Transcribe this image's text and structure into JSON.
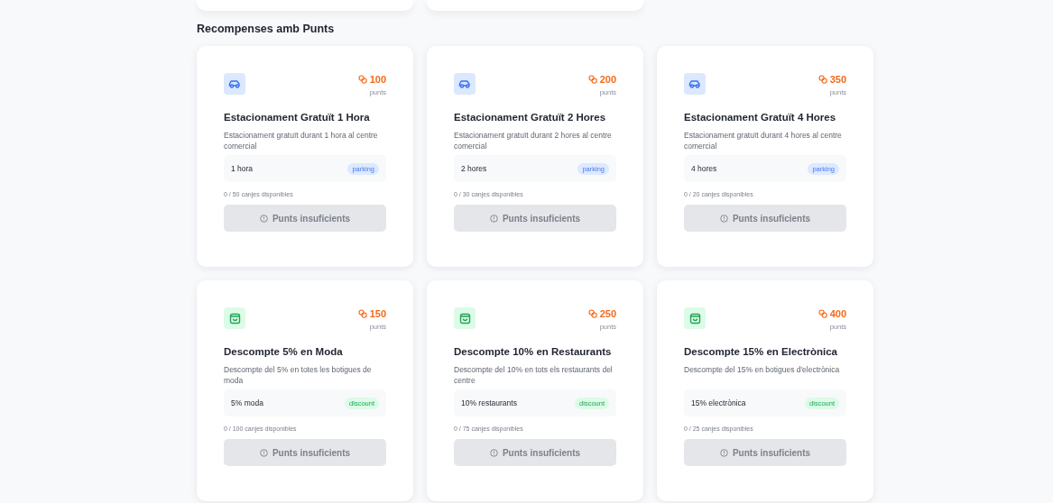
{
  "section_title": "Recompenses amb Punts",
  "rewards": [
    {
      "kind": "parking",
      "points": "100",
      "points_unit": "punts",
      "title": "Estacionament Gratuït 1 Hora",
      "description": "Estacionament gratuït durant 1 hora al centre comercial",
      "value": "1 hora",
      "tag": "parking",
      "availability": "0 / 50 canjes disponibles",
      "button": "Punts insuficients",
      "disabled": true
    },
    {
      "kind": "parking",
      "points": "200",
      "points_unit": "punts",
      "title": "Estacionament Gratuït 2 Hores",
      "description": "Estacionament gratuït durant 2 hores al centre comercial",
      "value": "2 hores",
      "tag": "parking",
      "availability": "0 / 30 canjes disponibles",
      "button": "Punts insuficients",
      "disabled": true
    },
    {
      "kind": "parking",
      "points": "350",
      "points_unit": "punts",
      "title": "Estacionament Gratuït 4 Hores",
      "description": "Estacionament gratuït durant 4 hores al centre comercial",
      "value": "4 hores",
      "tag": "parking",
      "availability": "0 / 20 canjes disponibles",
      "button": "Punts insuficients",
      "disabled": true
    },
    {
      "kind": "discount",
      "points": "150",
      "points_unit": "punts",
      "title": "Descompte 5% en Moda",
      "description": "Descompte del 5% en totes les botigues de moda",
      "value": "5% moda",
      "tag": "discount",
      "availability": "0 / 100 canjes disponibles",
      "button": "Punts insuficients",
      "disabled": true
    },
    {
      "kind": "discount",
      "points": "250",
      "points_unit": "punts",
      "title": "Descompte 10% en Restaurants",
      "description": "Descompte del 10% en tots els restaurants del centre",
      "value": "10% restaurants",
      "tag": "discount",
      "availability": "0 / 75 canjes disponibles",
      "button": "Punts insuficients",
      "disabled": true
    },
    {
      "kind": "discount",
      "points": "400",
      "points_unit": "punts",
      "title": "Descompte 15% en Electrònica",
      "description": "Descompte del 15% en botigues d'electrònica",
      "value": "15% electrònica",
      "tag": "discount",
      "availability": "0 / 25 canjes disponibles",
      "button": "Punts insuficients",
      "disabled": true
    }
  ]
}
